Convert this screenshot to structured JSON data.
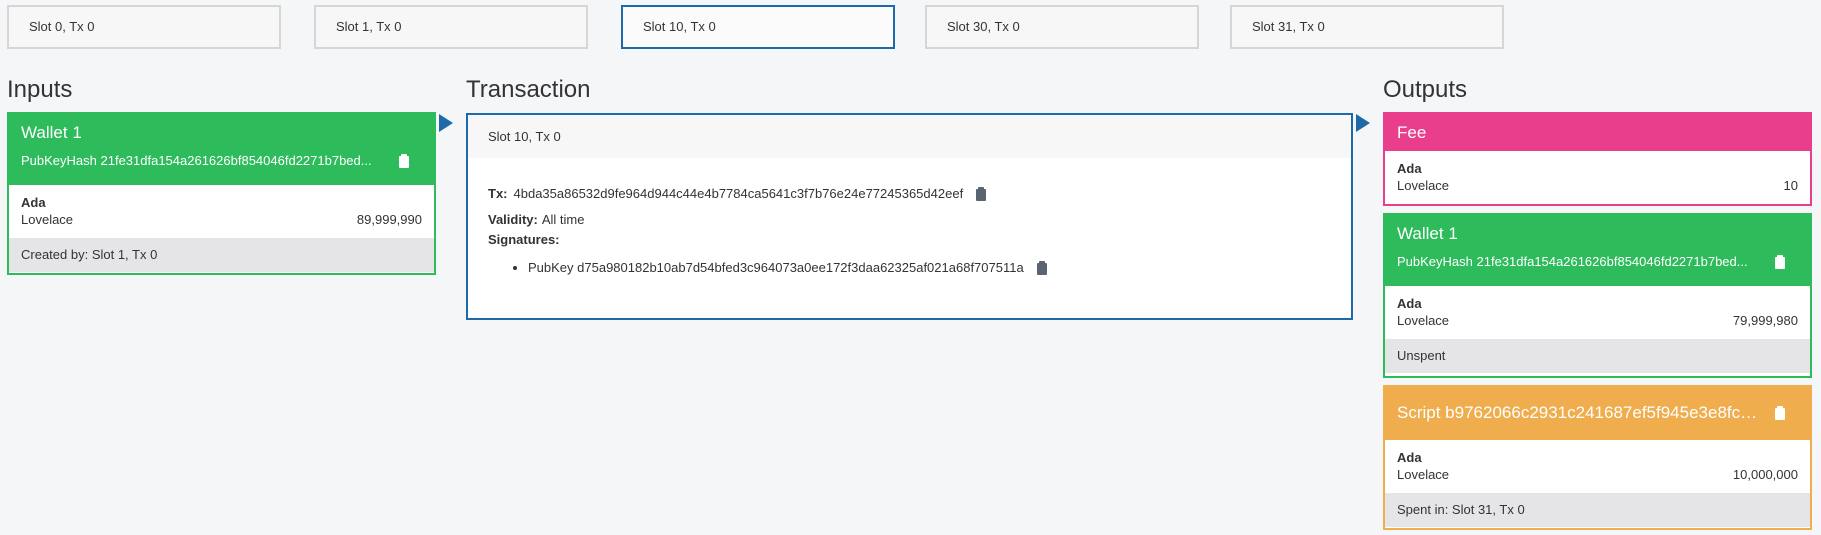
{
  "slots": [
    "Slot 0, Tx 0",
    "Slot 1, Tx 0",
    "Slot 10, Tx 0",
    "Slot 30, Tx 0",
    "Slot 31, Tx 0"
  ],
  "headings": {
    "inputs": "Inputs",
    "transaction": "Transaction",
    "outputs": "Outputs"
  },
  "inputs": [
    {
      "title": "Wallet 1",
      "subtitle": "PubKeyHash 21fe31dfa154a261626bf854046fd2271b7bed...",
      "asset": "Ada",
      "token": "Lovelace",
      "amount": "89,999,990",
      "footer": "Created by: Slot 1, Tx 0"
    }
  ],
  "transaction": {
    "header": "Slot 10, Tx 0",
    "tx_label": "Tx:",
    "tx_hash": "4bda35a86532d9fe964d944c44e4b7784ca5641c3f7b76e24e77245365d42eef",
    "validity_label": "Validity:",
    "validity_value": "All time",
    "signatures_label": "Signatures:",
    "signatures": [
      "PubKey d75a980182b10ab7d54bfed3c964073a0ee172f3daa62325af021a68f707511a"
    ]
  },
  "outputs": {
    "fee": {
      "title": "Fee",
      "asset": "Ada",
      "token": "Lovelace",
      "amount": "10"
    },
    "wallet": {
      "title": "Wallet 1",
      "subtitle": "PubKeyHash 21fe31dfa154a261626bf854046fd2271b7bed...",
      "asset": "Ada",
      "token": "Lovelace",
      "amount": "79,999,980",
      "footer": "Unspent"
    },
    "script": {
      "title": "Script b9762066c2931c241687ef5f945e3e8fc7...",
      "asset": "Ada",
      "token": "Lovelace",
      "amount": "10,000,000",
      "footer": "Spent in: Slot 31, Tx 0"
    }
  },
  "colors": {
    "wallet": "#2dbb5c",
    "fee": "#e83e8c",
    "script": "#f0ad4e",
    "accent": "#1e6aa8"
  },
  "icons": {
    "copy": "clipboard-icon",
    "flow": "arrow-right-icon"
  }
}
